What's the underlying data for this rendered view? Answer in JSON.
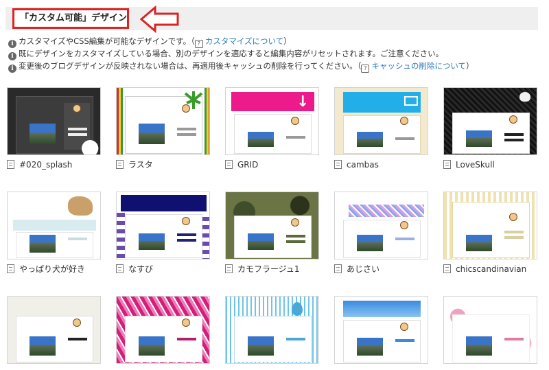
{
  "header": {
    "title": "「カスタム可能」デザイン"
  },
  "notes": [
    {
      "text": "カスタマイズやCSS編集が可能なデザインです。（",
      "link": "カスタマイズについて",
      "after": "）"
    },
    {
      "text": "既にデザインをカスタマイズしている場合、別のデザインを適応すると編集内容がリセットされます。ご注意ください。",
      "link": "",
      "after": ""
    },
    {
      "text": "変更後のブログデザインが反映されない場合は、再適用後キャッシュの削除を行ってください。（",
      "link": "キャッシュの削除について",
      "after": "）"
    }
  ],
  "icons": {
    "info": "info-icon",
    "help": "help-icon",
    "page": "page-icon",
    "arrow": "left-arrow-icon"
  },
  "colors": {
    "highlight": "#dd2222",
    "link": "#2a7ab8"
  },
  "designs": [
    {
      "name": "#020_splash"
    },
    {
      "name": "ラスタ"
    },
    {
      "name": "GRID"
    },
    {
      "name": "cambas"
    },
    {
      "name": "LoveSkull"
    },
    {
      "name": "やっぱり犬が好き"
    },
    {
      "name": "なすび"
    },
    {
      "name": "カモフラージュ1"
    },
    {
      "name": "あじさい"
    },
    {
      "name": "chicscandinavian"
    },
    {
      "name": ""
    },
    {
      "name": ""
    },
    {
      "name": ""
    },
    {
      "name": ""
    },
    {
      "name": ""
    }
  ]
}
